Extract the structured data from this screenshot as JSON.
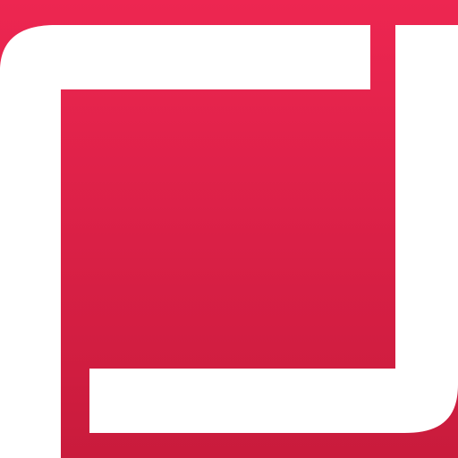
{
  "icon": {
    "name": "app-logo-icon",
    "colors": {
      "gradient_top": "#ED2651",
      "gradient_bottom": "#C91B3C",
      "foreground": "#FFFFFF"
    }
  }
}
